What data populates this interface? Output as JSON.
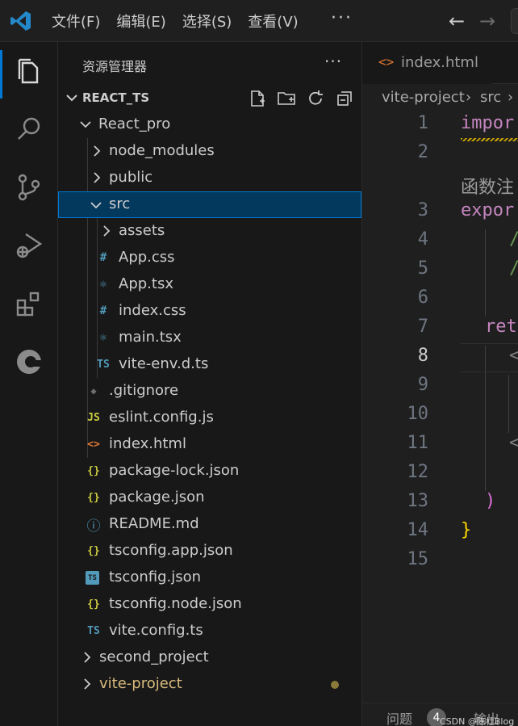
{
  "titlebar": {
    "menu": [
      "文件(F)",
      "编辑(E)",
      "选择(S)",
      "查看(V)"
    ],
    "more": "···",
    "back": "←",
    "forward": "→"
  },
  "activity": [
    "explorer-icon",
    "search-icon",
    "source-control-icon",
    "run-debug-icon",
    "extensions-icon",
    "remote-icon"
  ],
  "sidebar": {
    "title": "资源管理器",
    "more": "···",
    "root": "REACT_TS",
    "tree": [
      {
        "label": "React_pro",
        "kind": "folder-open"
      },
      {
        "label": "node_modules",
        "kind": "folder"
      },
      {
        "label": "public",
        "kind": "folder"
      },
      {
        "label": "src",
        "kind": "folder-open"
      },
      {
        "label": "assets",
        "kind": "folder"
      },
      {
        "label": "App.css",
        "kind": "css",
        "icon": "#"
      },
      {
        "label": "App.tsx",
        "kind": "react",
        "icon": "⚛"
      },
      {
        "label": "index.css",
        "kind": "css",
        "icon": "#"
      },
      {
        "label": "main.tsx",
        "kind": "react",
        "icon": "⚛"
      },
      {
        "label": "vite-env.d.ts",
        "kind": "ts",
        "icon": "TS"
      },
      {
        "label": ".gitignore",
        "kind": "git",
        "icon": "◆"
      },
      {
        "label": "eslint.config.js",
        "kind": "js",
        "icon": "JS"
      },
      {
        "label": "index.html",
        "kind": "html",
        "icon": "<>"
      },
      {
        "label": "package-lock.json",
        "kind": "json",
        "icon": "{}"
      },
      {
        "label": "package.json",
        "kind": "json",
        "icon": "{}"
      },
      {
        "label": "README.md",
        "kind": "info",
        "icon": "ⓘ"
      },
      {
        "label": "tsconfig.app.json",
        "kind": "json",
        "icon": "{}"
      },
      {
        "label": "tsconfig.json",
        "kind": "tsjson",
        "icon": "TS"
      },
      {
        "label": "tsconfig.node.json",
        "kind": "json",
        "icon": "{}"
      },
      {
        "label": "vite.config.ts",
        "kind": "ts",
        "icon": "TS"
      },
      {
        "label": "second_project",
        "kind": "folder"
      },
      {
        "label": "vite-project",
        "kind": "folder"
      }
    ]
  },
  "editor": {
    "tab": {
      "icon": "<>",
      "label": "index.html"
    },
    "breadcrumb": [
      "vite-project",
      "src"
    ],
    "line_numbers": [
      "1",
      "2",
      "3",
      "4",
      "5",
      "6",
      "7",
      "8",
      "9",
      "10",
      "11",
      "12",
      "13",
      "14",
      "15"
    ],
    "current_line": "8",
    "code": {
      "l1": "impor",
      "hint": "函数注",
      "l3": "expor",
      "l4": "/",
      "l5": "/",
      "l7": "ret",
      "l8": "<",
      "l11": "<",
      "l13": ")",
      "l14": "}"
    }
  },
  "panel": {
    "problems": "问题",
    "count": "4",
    "output": "输出",
    "watermark": "CSDN @陈杜Blog"
  },
  "colors": {
    "accent": "#0078d4",
    "folder_modified": "#d7ba7d",
    "keyword": "#c586c0",
    "bracket": "#ffd700"
  }
}
